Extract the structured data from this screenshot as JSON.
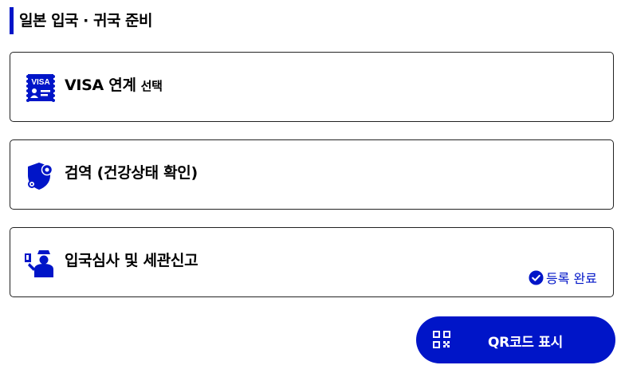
{
  "section": {
    "title": "일본 입국 · 귀국 준비"
  },
  "cards": [
    {
      "label": "VISA 연계",
      "sub": "선택",
      "icon": "visa-badge-icon"
    },
    {
      "label": "검역 (건강상태 확인)",
      "icon": "health-shield-gear-icon"
    },
    {
      "label": "입국심사 및 세관신고",
      "icon": "immigration-officer-icon",
      "status": "등록 완료",
      "status_icon": "check-circle-icon"
    }
  ],
  "visa_icon_text": "VISA",
  "qr_button": {
    "label": "QR코드 표시",
    "icon": "qr-code-icon"
  },
  "colors": {
    "accent": "#0015c8",
    "border": "#222222",
    "text": "#000000"
  }
}
